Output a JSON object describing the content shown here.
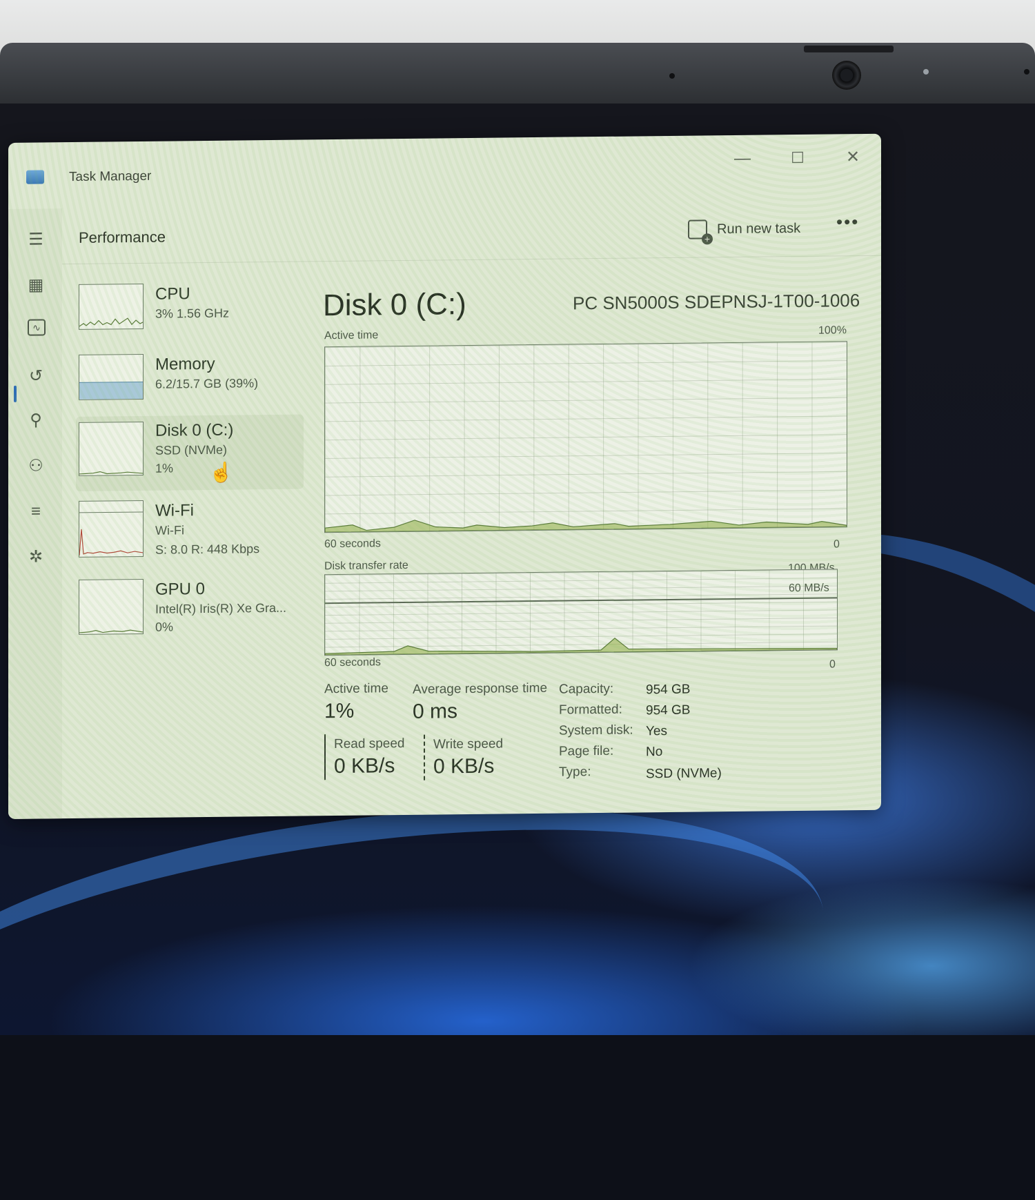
{
  "window": {
    "title": "Task Manager",
    "minimize": "—",
    "maximize": "☐",
    "close": "✕"
  },
  "header": {
    "title": "Performance",
    "run_task_label": "Run new task",
    "more_label": "•••"
  },
  "rail_icons": [
    "hamburger-icon",
    "processes-icon",
    "performance-icon",
    "app-history-icon",
    "startup-apps-icon",
    "users-icon",
    "details-icon",
    "services-icon",
    "settings-icon"
  ],
  "devices": [
    {
      "name": "CPU",
      "line1": "3%  1.56 GHz",
      "line2": ""
    },
    {
      "name": "Memory",
      "line1": "6.2/15.7 GB (39%)",
      "line2": ""
    },
    {
      "name": "Disk 0 (C:)",
      "line1": "SSD (NVMe)",
      "line2": "1%"
    },
    {
      "name": "Wi-Fi",
      "line1": "Wi-Fi",
      "line2": "S: 8.0  R: 448 Kbps"
    },
    {
      "name": "GPU 0",
      "line1": "Intel(R) Iris(R) Xe Gra...",
      "line2": "0%"
    }
  ],
  "main": {
    "title": "Disk 0 (C:)",
    "model": "PC SN5000S SDEPNSJ-1T00-1006",
    "graph1": {
      "label": "Active time",
      "max": "100%",
      "time": "60 seconds",
      "min": "0"
    },
    "graph2": {
      "label": "Disk transfer rate",
      "max": "100 MB/s",
      "mid": "60 MB/s",
      "time": "60 seconds",
      "min": "0"
    },
    "stats": {
      "active_time_label": "Active time",
      "active_time_value": "1%",
      "avg_resp_label": "Average response time",
      "avg_resp_value": "0 ms",
      "read_label": "Read speed",
      "read_value": "0 KB/s",
      "write_label": "Write speed",
      "write_value": "0 KB/s"
    },
    "properties": [
      {
        "key": "Capacity:",
        "value": "954 GB"
      },
      {
        "key": "Formatted:",
        "value": "954 GB"
      },
      {
        "key": "System disk:",
        "value": "Yes"
      },
      {
        "key": "Page file:",
        "value": "No"
      },
      {
        "key": "Type:",
        "value": "SSD (NVMe)"
      }
    ]
  },
  "colors": {
    "window_bg": "#dfe8d3",
    "graph_line": "#5a7a3a",
    "accent": "#2f6db6"
  }
}
